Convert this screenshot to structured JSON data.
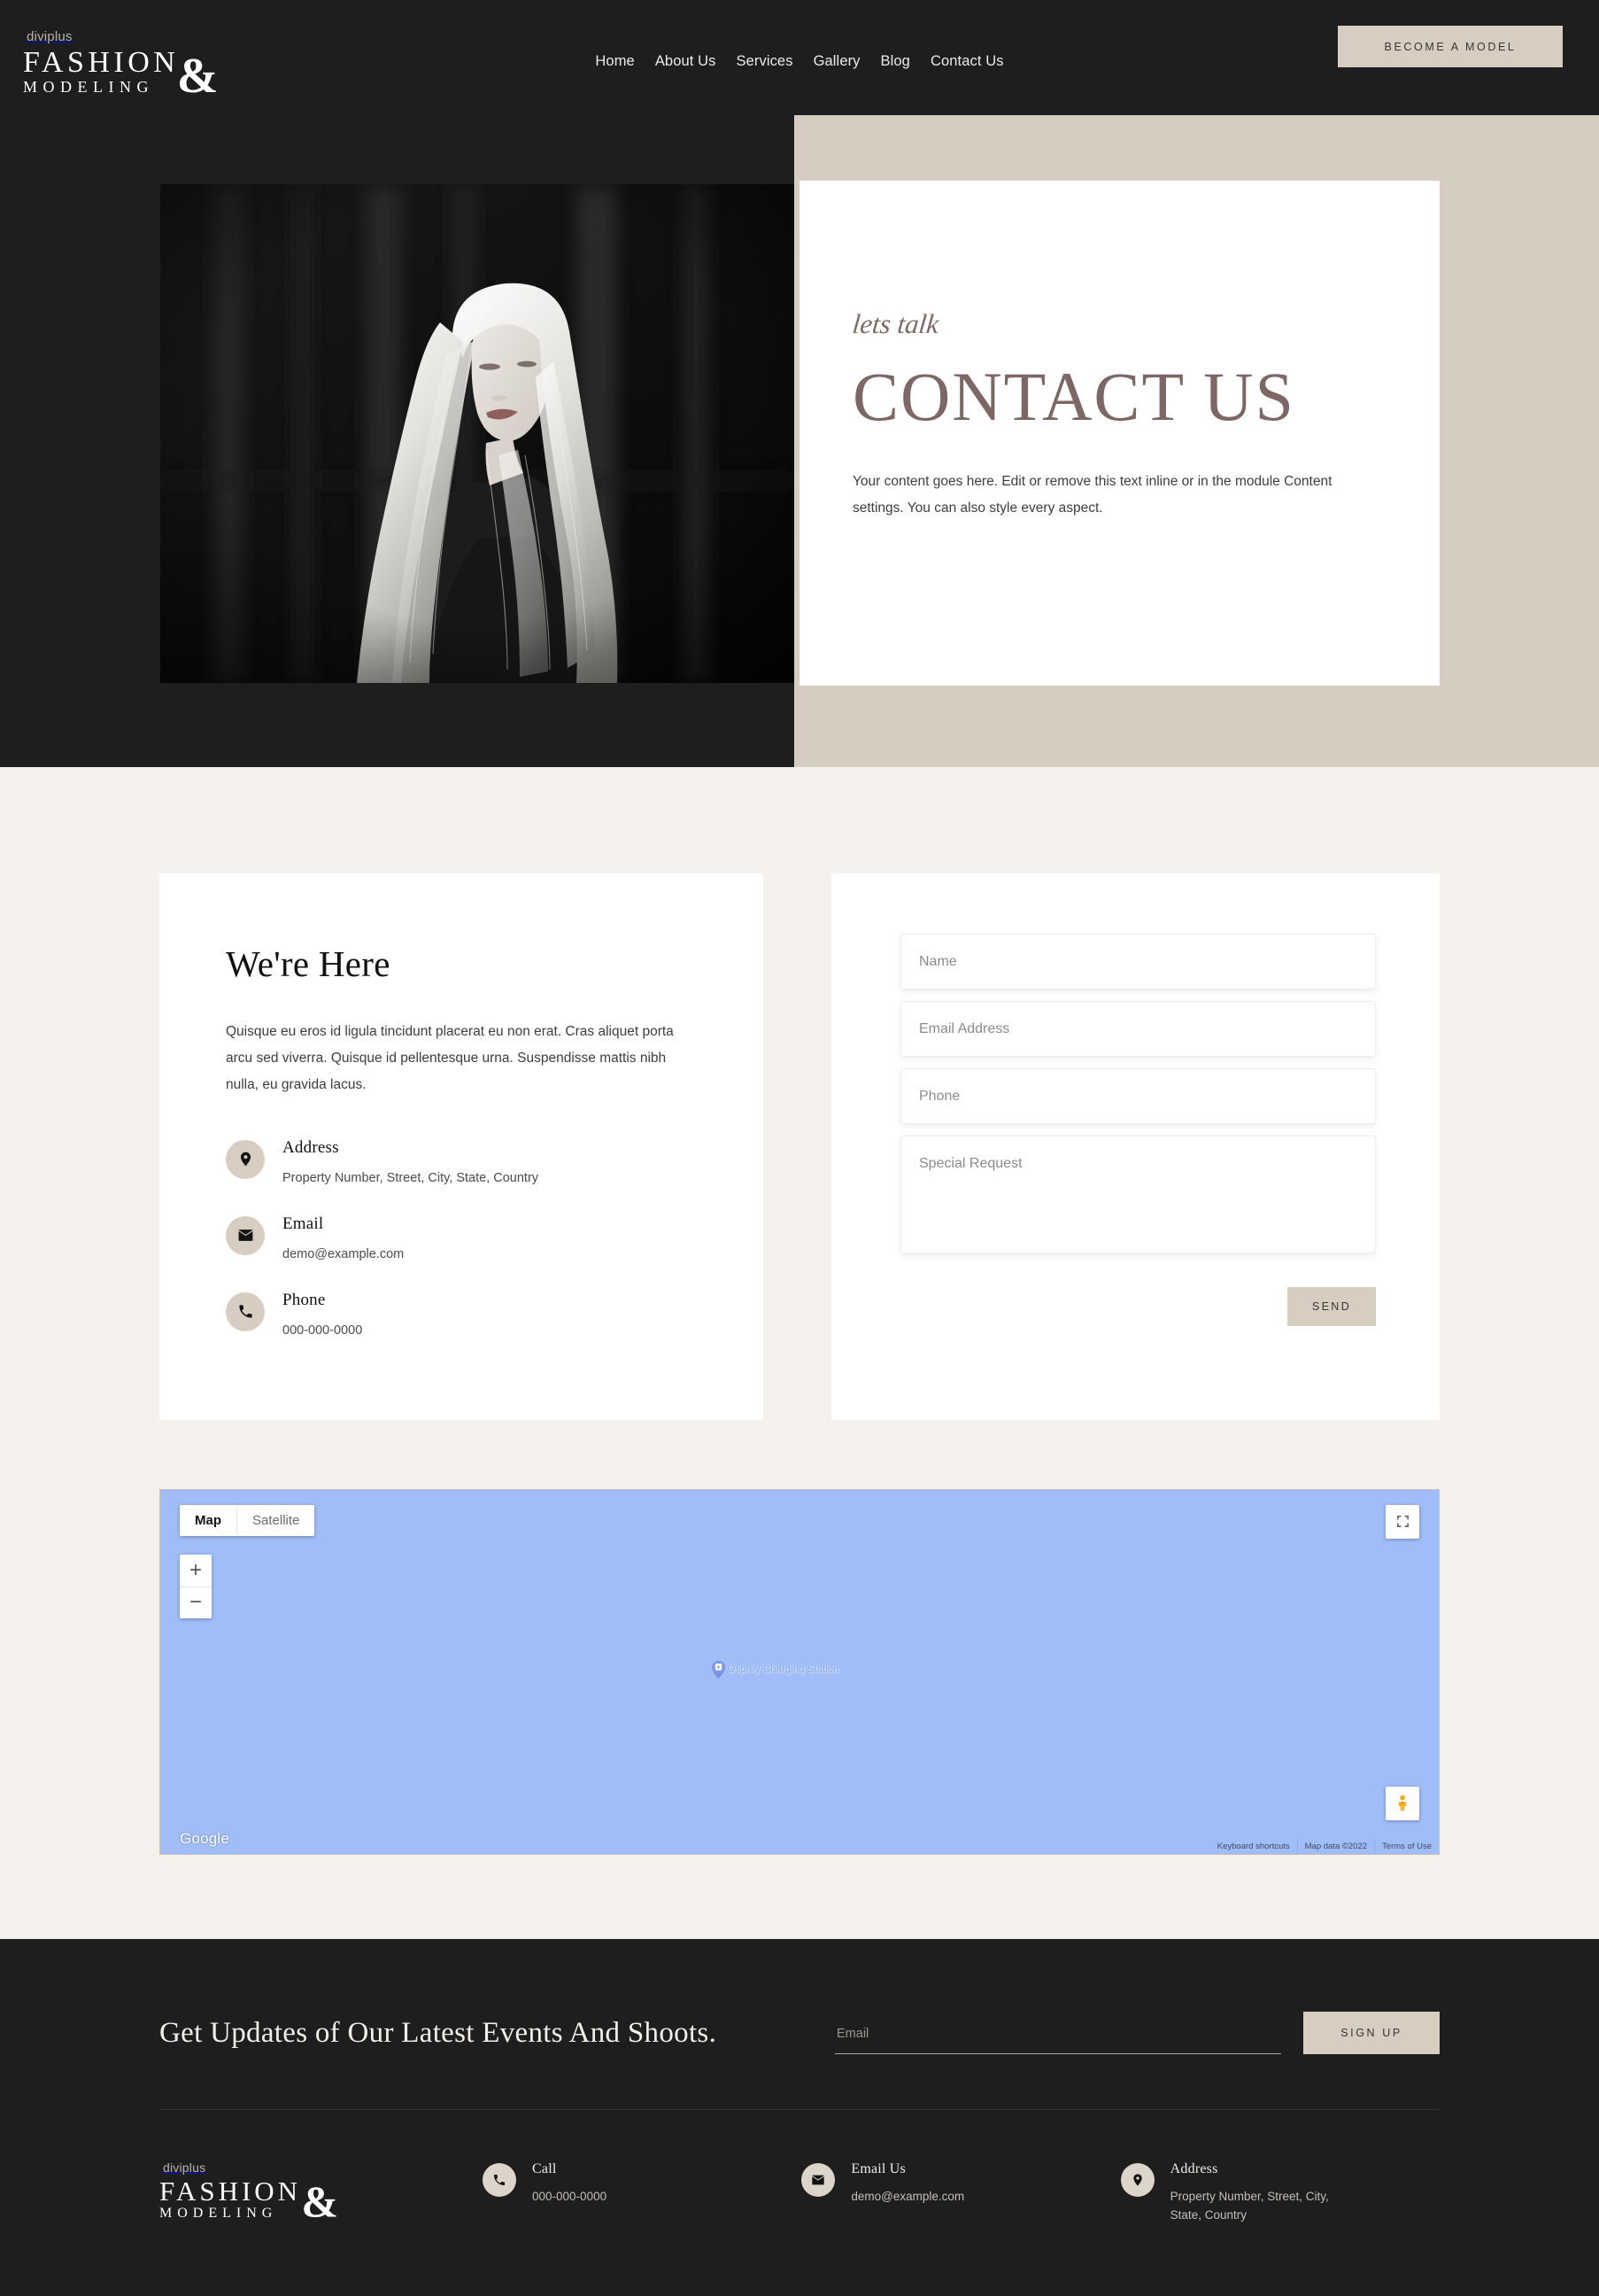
{
  "header": {
    "brand": {
      "eyebrow": "diviplus",
      "line1": "FASHION",
      "line2": "MODELING",
      "ampersand": "&"
    },
    "nav": [
      {
        "label": "Home"
      },
      {
        "label": "About Us"
      },
      {
        "label": "Services"
      },
      {
        "label": "Gallery"
      },
      {
        "label": "Blog"
      },
      {
        "label": "Contact Us"
      }
    ],
    "cta_label": "BECOME A MODEL"
  },
  "hero": {
    "script_text": "lets talk",
    "title": "CONTACT US",
    "body": "Your content goes here. Edit or remove this text inline or in the module Content settings. You can also style every aspect.",
    "image_alt": "black-and-white portrait of a model with long blonde hair"
  },
  "info_card": {
    "title": "We're Here",
    "description": "Quisque eu eros id ligula tincidunt placerat eu non erat. Cras aliquet porta arcu sed viverra. Quisque id pellentesque urna. Suspendisse mattis nibh nulla, eu gravida lacus.",
    "items": [
      {
        "icon": "map-pin-icon",
        "label": "Address",
        "value": "Property Number, Street, City, State, Country"
      },
      {
        "icon": "envelope-icon",
        "label": "Email",
        "value": "demo@example.com"
      },
      {
        "icon": "phone-icon",
        "label": "Phone",
        "value": "000-000-0000"
      }
    ]
  },
  "form": {
    "fields": [
      {
        "name": "name",
        "placeholder": "Name",
        "value": ""
      },
      {
        "name": "email",
        "placeholder": "Email Address",
        "value": ""
      },
      {
        "name": "phone",
        "placeholder": "Phone",
        "value": ""
      }
    ],
    "textarea": {
      "name": "special-request",
      "placeholder": "Special Request",
      "value": ""
    },
    "submit_label": "SEND"
  },
  "map": {
    "type_options": [
      {
        "label": "Map",
        "active": true
      },
      {
        "label": "Satellite",
        "active": false
      }
    ],
    "zoom_in": "+",
    "zoom_out": "−",
    "marker_label": "Osprey Charging Station",
    "logo": "Google",
    "attribution": [
      {
        "label": "Keyboard shortcuts"
      },
      {
        "label": "Map data ©2022"
      },
      {
        "label": "Terms of Use"
      }
    ]
  },
  "footer": {
    "newsletter": {
      "title": "Get Updates of Our Latest Events And Shoots.",
      "input_placeholder": "Email",
      "input_value": "",
      "button_label": "SIGN UP"
    },
    "brand": {
      "eyebrow": "diviplus",
      "line1": "FASHION",
      "line2": "MODELING",
      "ampersand": "&"
    },
    "contacts": [
      {
        "icon": "phone-icon",
        "label": "Call",
        "value": "000-000-0000"
      },
      {
        "icon": "envelope-icon",
        "label": "Email Us",
        "value": "demo@example.com"
      },
      {
        "icon": "map-pin-icon",
        "label": "Address",
        "value": "Property Number, Street, City, State, Country"
      }
    ]
  },
  "colors": {
    "dark": "#1e1e1e",
    "accent_tan": "#d7cec1",
    "hero_band": "#d5cdc0",
    "page_bg": "#f5f1ec",
    "heading_mauve": "#7c6764",
    "map_blue": "#a0bdf8"
  }
}
